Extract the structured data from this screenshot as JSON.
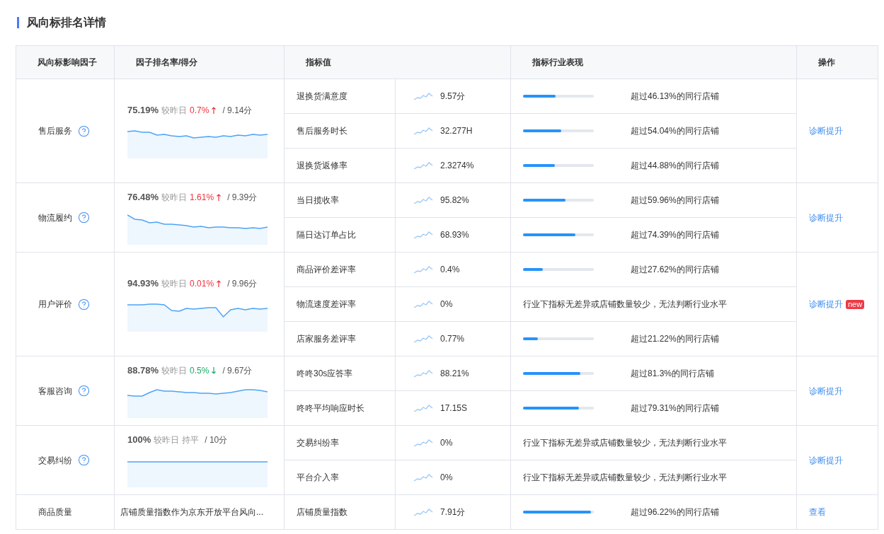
{
  "title": "风向标排名详情",
  "columns": [
    "风向标影响因子",
    "因子排名率/得分",
    "指标值",
    "指标行业表现",
    "操作"
  ],
  "factors": [
    {
      "name": "售后服务",
      "help": true,
      "rank": {
        "percent": "75.19%",
        "compare_label": "较昨日",
        "change": "0.7%",
        "kind": "up",
        "score": "/ 9.14分"
      },
      "metrics": [
        {
          "name": "退换货满意度",
          "value": "9.57分",
          "performance": {
            "kind": "bar",
            "level": 0.4613,
            "text": "超过46.13%的同行店铺"
          }
        },
        {
          "name": "售后服务时长",
          "value": "32.277H",
          "performance": {
            "kind": "bar",
            "level": 0.5404,
            "text": "超过54.04%的同行店铺"
          }
        },
        {
          "name": "退换货返修率",
          "value": "2.3274%",
          "performance": {
            "kind": "bar",
            "level": 0.4488,
            "text": "超过44.88%的同行店铺"
          }
        }
      ],
      "action": {
        "label": "诊断提升"
      }
    },
    {
      "name": "物流履约",
      "help": true,
      "rank": {
        "percent": "76.48%",
        "compare_label": "较昨日",
        "change": "1.61%",
        "kind": "up",
        "score": "/ 9.39分"
      },
      "metrics": [
        {
          "name": "当日揽收率",
          "value": "95.82%",
          "performance": {
            "kind": "bar",
            "level": 0.5996,
            "text": "超过59.96%的同行店铺"
          }
        },
        {
          "name": "隔日达订单占比",
          "value": "68.93%",
          "performance": {
            "kind": "bar",
            "level": 0.7439,
            "text": "超过74.39%的同行店铺"
          }
        }
      ],
      "action": {
        "label": "诊断提升"
      }
    },
    {
      "name": "用户评价",
      "help": true,
      "rank": {
        "percent": "94.93%",
        "compare_label": "较昨日",
        "change": "0.01%",
        "kind": "up",
        "score": "/ 9.96分"
      },
      "metrics": [
        {
          "name": "商品评价差评率",
          "value": "0.4%",
          "performance": {
            "kind": "bar",
            "level": 0.2762,
            "text": "超过27.62%的同行店铺"
          }
        },
        {
          "name": "物流速度差评率",
          "value": "0%",
          "performance": {
            "kind": "note",
            "text": "行业下指标无差异或店铺数量较少，无法判断行业水平"
          }
        },
        {
          "name": "店家服务差评率",
          "value": "0.77%",
          "performance": {
            "kind": "bar",
            "level": 0.2122,
            "text": "超过21.22%的同行店铺"
          }
        }
      ],
      "action": {
        "label": "诊断提升",
        "badge": "new"
      }
    },
    {
      "name": "客服咨询",
      "help": true,
      "rank": {
        "percent": "88.78%",
        "compare_label": "较昨日",
        "change": "0.5%",
        "kind": "down",
        "score": "/ 9.67分"
      },
      "metrics": [
        {
          "name": "咚咚30s应答率",
          "value": "88.21%",
          "performance": {
            "kind": "bar",
            "level": 0.813,
            "text": "超过81.3%的同行店铺"
          }
        },
        {
          "name": "咚咚平均响应时长",
          "value": "17.15S",
          "performance": {
            "kind": "bar",
            "level": 0.7931,
            "text": "超过79.31%的同行店铺"
          }
        }
      ],
      "action": {
        "label": "诊断提升"
      }
    },
    {
      "name": "交易纠纷",
      "help": true,
      "rank": {
        "percent": "100%",
        "compare_label": "较昨日",
        "change": "持平",
        "kind": "flat",
        "score": "/ 10分"
      },
      "metrics": [
        {
          "name": "交易纠纷率",
          "value": "0%",
          "performance": {
            "kind": "note",
            "text": "行业下指标无差异或店铺数量较少，无法判断行业水平"
          }
        },
        {
          "name": "平台介入率",
          "value": "0%",
          "performance": {
            "kind": "note",
            "text": "行业下指标无差异或店铺数量较少，无法判断行业水平"
          }
        }
      ],
      "action": {
        "label": "诊断提升"
      }
    },
    {
      "name": "商品质量",
      "help": false,
      "description": "店铺质量指数作为京东开放平台风向...",
      "metrics": [
        {
          "name": "店铺质量指数",
          "value": "7.91分",
          "performance": {
            "kind": "bar",
            "level": 0.9622,
            "text": "超过96.22%的同行店铺"
          }
        }
      ],
      "action": {
        "label": "查看"
      }
    }
  ]
}
